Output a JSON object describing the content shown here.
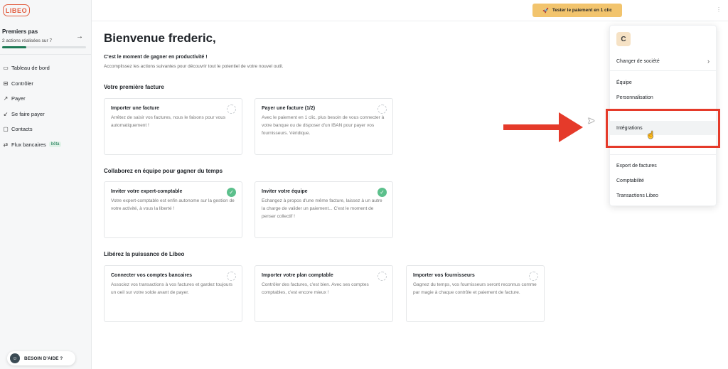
{
  "brand": {
    "logo_text": "LIBEO",
    "accent": "#e25d3f",
    "success": "#5cc08c",
    "cta_color": "#f2c46d",
    "annotation_color": "#e53a2a"
  },
  "onboarding": {
    "title": "Premiers pas",
    "subtitle": "2 actions réalisées sur 7",
    "progress": 0.2857
  },
  "sidebar": {
    "items": [
      {
        "label": "Tableau de bord",
        "icon": "dashboard-icon"
      },
      {
        "label": "Contrôler",
        "icon": "inbox-icon"
      },
      {
        "label": "Payer",
        "icon": "pay-icon"
      },
      {
        "label": "Se faire payer",
        "icon": "receive-icon"
      },
      {
        "label": "Contacts",
        "icon": "contacts-icon"
      },
      {
        "label": "Flux bancaires",
        "icon": "transfer-icon",
        "badge": "bêta"
      }
    ]
  },
  "help": {
    "label": "BESOIN D'AIDE ?"
  },
  "topbar": {
    "cta_label": "Tester le paiement en 1 clic"
  },
  "main": {
    "welcome": "Bienvenue frederic,",
    "lead": "C'est le moment de gagner en productivité !",
    "lead_sub": "Accomplissez les actions suivantes pour découvrir tout le potentiel de votre nouvel outil.",
    "sections": [
      {
        "title": "Votre première facture",
        "cards": [
          {
            "title": "Importer une facture",
            "desc": "Arrêtez de saisir vos factures, nous le faisons pour vous automatiquement !",
            "done": false
          },
          {
            "title": "Payer une facture (1/2)",
            "desc": "Avec le paiement en 1 clic, plus besoin de vous connecter à votre banque ou de disposer d'un IBAN pour payer vos fournisseurs. Véridique.",
            "done": false
          }
        ]
      },
      {
        "title": "Collaborez en équipe pour gagner du temps",
        "cards": [
          {
            "title": "Inviter votre expert-comptable",
            "desc": "Votre expert-comptable est enfin autonome sur la gestion de votre activité, à vous la liberté !",
            "done": true
          },
          {
            "title": "Inviter votre équipe",
            "desc": "Echangez à propos d'une même facture, laissez à un autre la charge de valider un paiement... C'est le moment de penser collectif !",
            "done": true
          }
        ]
      },
      {
        "title": "Libérez la puissance de Libeo",
        "cards": [
          {
            "title": "Connecter vos comptes bancaires",
            "desc": "Associez vos transactions à vos factures et gardez toujours un oeil sur votre solde avant de payer.",
            "done": false
          },
          {
            "title": "Importer votre plan comptable",
            "desc": "Contrôler des factures, c'est bien. Avec ses comptes comptables, c'est encore mieux !",
            "done": false
          },
          {
            "title": "Importer vos fournisseurs",
            "desc": "Gagnez du temps, vos fournisseurs seront reconnus comme par magie à chaque contrôle et paiement de facture.",
            "done": false
          }
        ]
      }
    ]
  },
  "dropdown": {
    "avatar_letter": "C",
    "change_company": "Changer de société",
    "items": [
      "Équipe",
      "Personnalisation",
      "Intégrations",
      "Export de factures",
      "Comptabilité",
      "Transactions Libeo"
    ]
  }
}
